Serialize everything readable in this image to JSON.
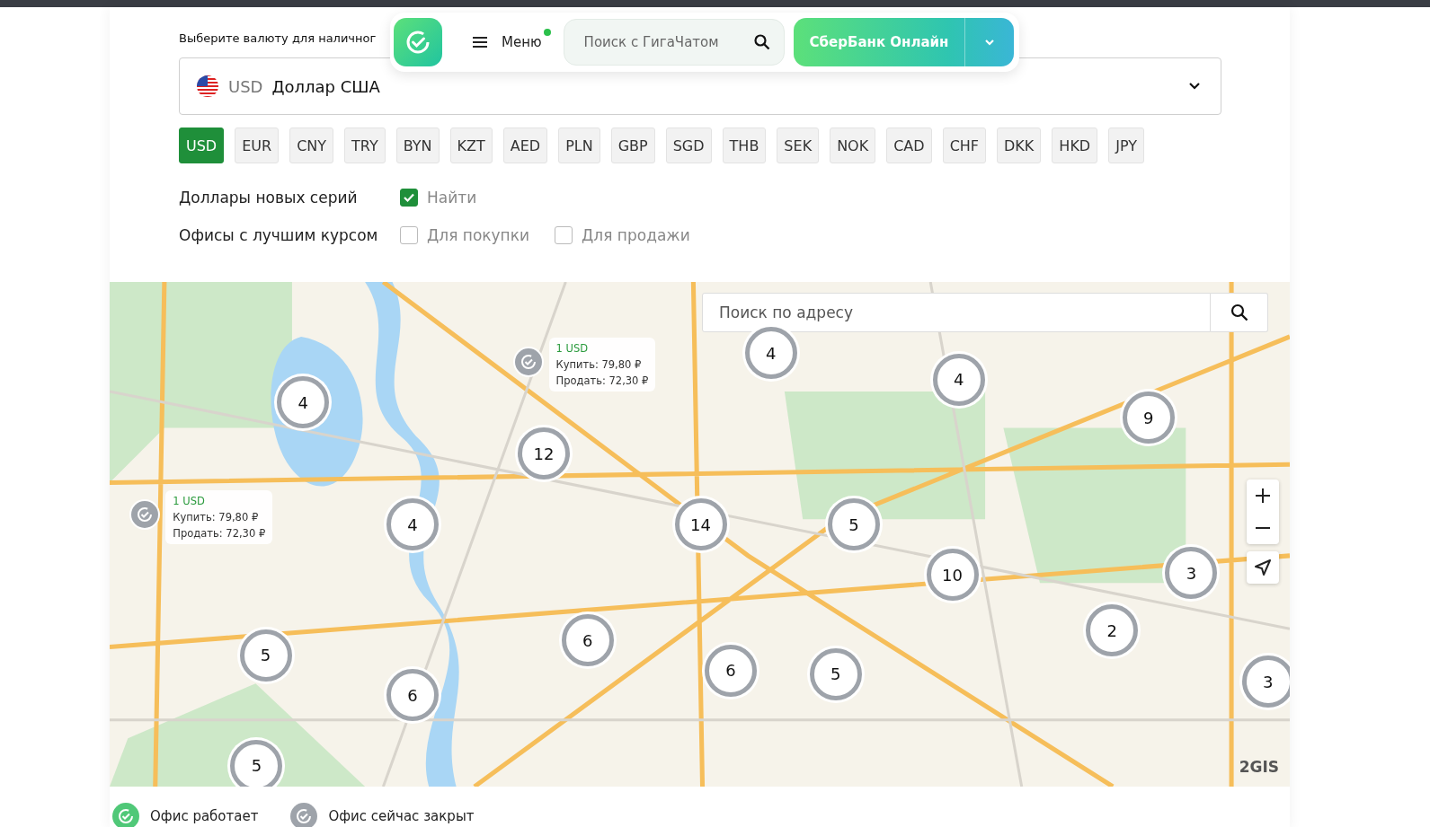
{
  "header": {
    "menu_label": "Меню",
    "menu_notification": true,
    "search_placeholder": "Поиск с ГигаЧатом",
    "online_button": "СберБанк Онлайн"
  },
  "currency_select": {
    "label": "Выберите валюту для наличног",
    "code": "USD",
    "name": "Доллар США"
  },
  "currencies": [
    {
      "label": "USD",
      "selected": true
    },
    {
      "label": "EUR",
      "selected": false
    },
    {
      "label": "CNY",
      "selected": false
    },
    {
      "label": "TRY",
      "selected": false
    },
    {
      "label": "BYN",
      "selected": false
    },
    {
      "label": "KZT",
      "selected": false
    },
    {
      "label": "AED",
      "selected": false
    },
    {
      "label": "PLN",
      "selected": false
    },
    {
      "label": "GBP",
      "selected": false
    },
    {
      "label": "SGD",
      "selected": false
    },
    {
      "label": "THB",
      "selected": false
    },
    {
      "label": "SEK",
      "selected": false
    },
    {
      "label": "NOK",
      "selected": false
    },
    {
      "label": "CAD",
      "selected": false
    },
    {
      "label": "CHF",
      "selected": false
    },
    {
      "label": "DKK",
      "selected": false
    },
    {
      "label": "HKD",
      "selected": false
    },
    {
      "label": "JPY",
      "selected": false
    }
  ],
  "filters": [
    {
      "label": "Доллары новых серий",
      "options": [
        {
          "label": "Найти",
          "checked": true
        }
      ]
    },
    {
      "label": "Офисы с лучшим курсом",
      "options": [
        {
          "label": "Для покупки",
          "checked": false
        },
        {
          "label": "Для продажи",
          "checked": false
        }
      ]
    }
  ],
  "map": {
    "search_placeholder": "Поиск по адресу",
    "logo": "2GIS",
    "clusters": [
      {
        "count": "4"
      },
      {
        "count": "12"
      },
      {
        "count": "4"
      },
      {
        "count": "14"
      },
      {
        "count": "4"
      },
      {
        "count": "4"
      },
      {
        "count": "9"
      },
      {
        "count": "5"
      },
      {
        "count": "10"
      },
      {
        "count": "3"
      },
      {
        "count": "2"
      },
      {
        "count": "3"
      },
      {
        "count": "5"
      },
      {
        "count": "6"
      },
      {
        "count": "6"
      },
      {
        "count": "6"
      },
      {
        "count": "5"
      },
      {
        "count": "5"
      }
    ],
    "offices": [
      {
        "open": false,
        "amount": "1 USD",
        "buy": "Купить: 79,80 ₽",
        "sell": "Продать: 72,30 ₽"
      },
      {
        "open": false,
        "amount": "1 USD",
        "buy": "Купить: 79,80 ₽",
        "sell": "Продать: 72,30 ₽"
      }
    ]
  },
  "legend": [
    {
      "open": true,
      "label": "Офис работает"
    },
    {
      "open": false,
      "label": "Офис сейчас закрыт"
    }
  ]
}
